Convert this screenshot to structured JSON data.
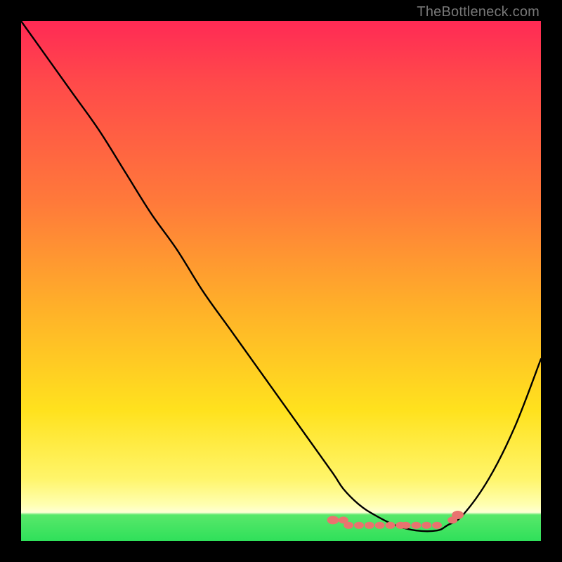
{
  "watermark": "TheBottleneck.com",
  "chart_data": {
    "type": "line",
    "title": "",
    "xlabel": "",
    "ylabel": "",
    "ylim": [
      0,
      100
    ],
    "series": [
      {
        "name": "bottleneck-curve",
        "x": [
          0,
          5,
          10,
          15,
          20,
          25,
          30,
          35,
          40,
          45,
          50,
          55,
          60,
          62,
          65,
          68,
          72,
          76,
          80,
          82,
          85,
          90,
          95,
          100
        ],
        "values": [
          100,
          93,
          86,
          79,
          71,
          63,
          56,
          48,
          41,
          34,
          27,
          20,
          13,
          10,
          7,
          5,
          3,
          2,
          2,
          3,
          5,
          12,
          22,
          35
        ]
      },
      {
        "name": "recommended-range-dots",
        "x": [
          60,
          62,
          63,
          65,
          67,
          69,
          71,
          73,
          74,
          76,
          78,
          80,
          83,
          84
        ],
        "values": [
          4,
          4,
          3,
          3,
          3,
          3,
          3,
          3,
          3,
          3,
          3,
          3,
          4,
          5
        ]
      }
    ]
  },
  "colors": {
    "curve": "#000000",
    "dots": "#e9736f",
    "gradient_top": "#ff2a55",
    "gradient_mid": "#ffe21e",
    "gradient_bottom": "#2fe05a"
  }
}
